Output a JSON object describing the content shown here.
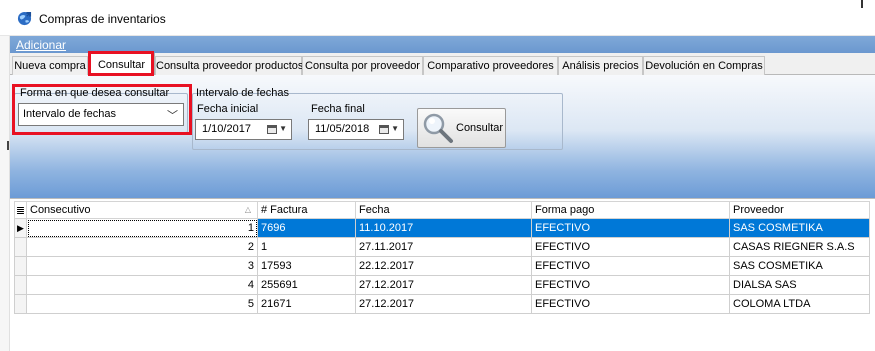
{
  "window": {
    "title": "Compras de inventarios"
  },
  "menu": {
    "items": [
      "Adicionar"
    ]
  },
  "tabs": [
    {
      "label": "Nueva compra",
      "active": false
    },
    {
      "label": "Consultar",
      "active": true
    },
    {
      "label": "Consulta proveedor productos",
      "active": false
    },
    {
      "label": "Consulta por proveedor",
      "active": false
    },
    {
      "label": "Comparativo proveedores",
      "active": false
    },
    {
      "label": "Análisis precios",
      "active": false
    },
    {
      "label": "Devolución en Compras",
      "active": false
    }
  ],
  "consult_mode": {
    "legend": "Forma en que desea consultar",
    "selected": "Intervalo de fechas"
  },
  "date_range": {
    "legend": "Intervalo de fechas",
    "start_label": "Fecha inicial",
    "start_value": "1/10/2017",
    "end_label": "Fecha final",
    "end_value": "11/05/2018"
  },
  "consult_button": {
    "label": "Consultar"
  },
  "table": {
    "columns": [
      "Consecutivo",
      "# Factura",
      "Fecha",
      "Forma pago",
      "Proveedor"
    ],
    "rows": [
      {
        "consecutivo": "1",
        "factura": "7696",
        "fecha": "11.10.2017",
        "forma_pago": "EFECTIVO",
        "proveedor": "SAS COSMETIKA",
        "selected": true
      },
      {
        "consecutivo": "2",
        "factura": "1",
        "fecha": "27.11.2017",
        "forma_pago": "EFECTIVO",
        "proveedor": "CASAS RIEGNER S.A.S",
        "selected": false
      },
      {
        "consecutivo": "3",
        "factura": "17593",
        "fecha": "22.12.2017",
        "forma_pago": "EFECTIVO",
        "proveedor": "SAS COSMETIKA",
        "selected": false
      },
      {
        "consecutivo": "4",
        "factura": "255691",
        "fecha": "27.12.2017",
        "forma_pago": "EFECTIVO",
        "proveedor": "DIALSA SAS",
        "selected": false
      },
      {
        "consecutivo": "5",
        "factura": "21671",
        "fecha": "27.12.2017",
        "forma_pago": "EFECTIVO",
        "proveedor": "COLOMA LTDA",
        "selected": false
      }
    ]
  },
  "colors": {
    "selection": "#0078d7",
    "highlight": "#e81123",
    "menubar": "#6b98cf"
  }
}
